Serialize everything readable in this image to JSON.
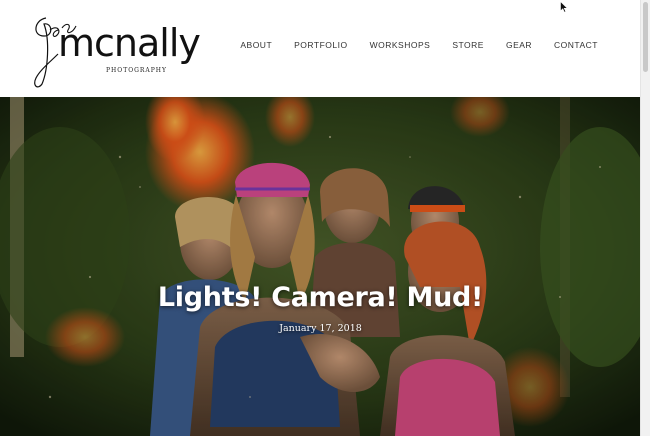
{
  "site": {
    "logo_name": "mcnally",
    "logo_script": "joe",
    "logo_sub": "PHOTOGRAPHY"
  },
  "nav": {
    "items": [
      {
        "label": "ABOUT"
      },
      {
        "label": "PORTFOLIO"
      },
      {
        "label": "WORKSHOPS"
      },
      {
        "label": "STORE"
      },
      {
        "label": "GEAR"
      },
      {
        "label": "CONTACT"
      }
    ]
  },
  "hero": {
    "title": "Lights! Camera! Mud!",
    "date": "January 17, 2018"
  },
  "colors": {
    "nav_text": "#333333",
    "hero_text": "#ffffff",
    "flame": "#e8571a",
    "foliage": "#2c4a1a"
  },
  "icons": {
    "cursor": "mouse-pointer-icon"
  }
}
